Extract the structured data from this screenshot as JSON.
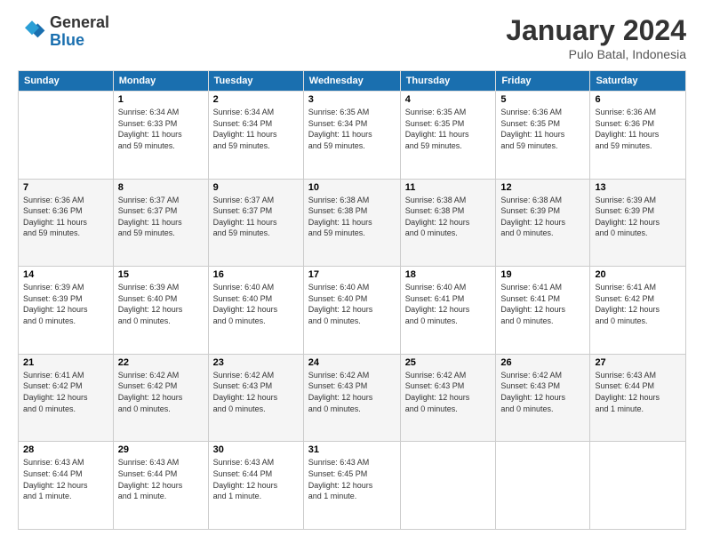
{
  "logo": {
    "line1": "General",
    "line2": "Blue"
  },
  "title": "January 2024",
  "subtitle": "Pulo Batal, Indonesia",
  "days_of_week": [
    "Sunday",
    "Monday",
    "Tuesday",
    "Wednesday",
    "Thursday",
    "Friday",
    "Saturday"
  ],
  "weeks": [
    [
      {
        "day": "",
        "info": ""
      },
      {
        "day": "1",
        "info": "Sunrise: 6:34 AM\nSunset: 6:33 PM\nDaylight: 11 hours\nand 59 minutes."
      },
      {
        "day": "2",
        "info": "Sunrise: 6:34 AM\nSunset: 6:34 PM\nDaylight: 11 hours\nand 59 minutes."
      },
      {
        "day": "3",
        "info": "Sunrise: 6:35 AM\nSunset: 6:34 PM\nDaylight: 11 hours\nand 59 minutes."
      },
      {
        "day": "4",
        "info": "Sunrise: 6:35 AM\nSunset: 6:35 PM\nDaylight: 11 hours\nand 59 minutes."
      },
      {
        "day": "5",
        "info": "Sunrise: 6:36 AM\nSunset: 6:35 PM\nDaylight: 11 hours\nand 59 minutes."
      },
      {
        "day": "6",
        "info": "Sunrise: 6:36 AM\nSunset: 6:36 PM\nDaylight: 11 hours\nand 59 minutes."
      }
    ],
    [
      {
        "day": "7",
        "info": "Sunrise: 6:36 AM\nSunset: 6:36 PM\nDaylight: 11 hours\nand 59 minutes."
      },
      {
        "day": "8",
        "info": "Sunrise: 6:37 AM\nSunset: 6:37 PM\nDaylight: 11 hours\nand 59 minutes."
      },
      {
        "day": "9",
        "info": "Sunrise: 6:37 AM\nSunset: 6:37 PM\nDaylight: 11 hours\nand 59 minutes."
      },
      {
        "day": "10",
        "info": "Sunrise: 6:38 AM\nSunset: 6:38 PM\nDaylight: 11 hours\nand 59 minutes."
      },
      {
        "day": "11",
        "info": "Sunrise: 6:38 AM\nSunset: 6:38 PM\nDaylight: 12 hours\nand 0 minutes."
      },
      {
        "day": "12",
        "info": "Sunrise: 6:38 AM\nSunset: 6:39 PM\nDaylight: 12 hours\nand 0 minutes."
      },
      {
        "day": "13",
        "info": "Sunrise: 6:39 AM\nSunset: 6:39 PM\nDaylight: 12 hours\nand 0 minutes."
      }
    ],
    [
      {
        "day": "14",
        "info": "Sunrise: 6:39 AM\nSunset: 6:39 PM\nDaylight: 12 hours\nand 0 minutes."
      },
      {
        "day": "15",
        "info": "Sunrise: 6:39 AM\nSunset: 6:40 PM\nDaylight: 12 hours\nand 0 minutes."
      },
      {
        "day": "16",
        "info": "Sunrise: 6:40 AM\nSunset: 6:40 PM\nDaylight: 12 hours\nand 0 minutes."
      },
      {
        "day": "17",
        "info": "Sunrise: 6:40 AM\nSunset: 6:40 PM\nDaylight: 12 hours\nand 0 minutes."
      },
      {
        "day": "18",
        "info": "Sunrise: 6:40 AM\nSunset: 6:41 PM\nDaylight: 12 hours\nand 0 minutes."
      },
      {
        "day": "19",
        "info": "Sunrise: 6:41 AM\nSunset: 6:41 PM\nDaylight: 12 hours\nand 0 minutes."
      },
      {
        "day": "20",
        "info": "Sunrise: 6:41 AM\nSunset: 6:42 PM\nDaylight: 12 hours\nand 0 minutes."
      }
    ],
    [
      {
        "day": "21",
        "info": "Sunrise: 6:41 AM\nSunset: 6:42 PM\nDaylight: 12 hours\nand 0 minutes."
      },
      {
        "day": "22",
        "info": "Sunrise: 6:42 AM\nSunset: 6:42 PM\nDaylight: 12 hours\nand 0 minutes."
      },
      {
        "day": "23",
        "info": "Sunrise: 6:42 AM\nSunset: 6:43 PM\nDaylight: 12 hours\nand 0 minutes."
      },
      {
        "day": "24",
        "info": "Sunrise: 6:42 AM\nSunset: 6:43 PM\nDaylight: 12 hours\nand 0 minutes."
      },
      {
        "day": "25",
        "info": "Sunrise: 6:42 AM\nSunset: 6:43 PM\nDaylight: 12 hours\nand 0 minutes."
      },
      {
        "day": "26",
        "info": "Sunrise: 6:42 AM\nSunset: 6:43 PM\nDaylight: 12 hours\nand 0 minutes."
      },
      {
        "day": "27",
        "info": "Sunrise: 6:43 AM\nSunset: 6:44 PM\nDaylight: 12 hours\nand 1 minute."
      }
    ],
    [
      {
        "day": "28",
        "info": "Sunrise: 6:43 AM\nSunset: 6:44 PM\nDaylight: 12 hours\nand 1 minute."
      },
      {
        "day": "29",
        "info": "Sunrise: 6:43 AM\nSunset: 6:44 PM\nDaylight: 12 hours\nand 1 minute."
      },
      {
        "day": "30",
        "info": "Sunrise: 6:43 AM\nSunset: 6:44 PM\nDaylight: 12 hours\nand 1 minute."
      },
      {
        "day": "31",
        "info": "Sunrise: 6:43 AM\nSunset: 6:45 PM\nDaylight: 12 hours\nand 1 minute."
      },
      {
        "day": "",
        "info": ""
      },
      {
        "day": "",
        "info": ""
      },
      {
        "day": "",
        "info": ""
      }
    ]
  ],
  "colors": {
    "header_bg": "#1a6faf",
    "header_text": "#ffffff",
    "alt_row": "#f5f5f5"
  }
}
